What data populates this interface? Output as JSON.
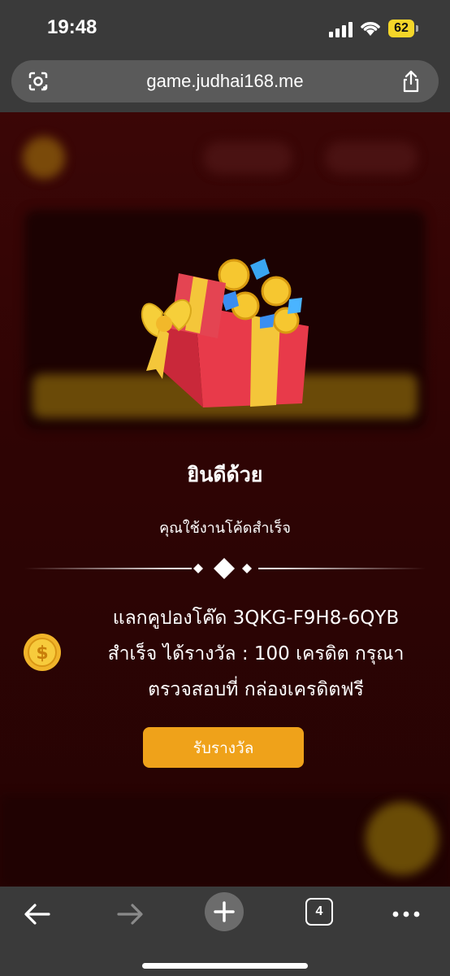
{
  "status_bar": {
    "time": "19:48",
    "battery": "62"
  },
  "browser": {
    "url": "game.judhai168.me",
    "open_tabs": "4"
  },
  "dialog": {
    "title": "ยินดีด้วย",
    "subtitle": "คุณใช้งานโค้ดสำเร็จ",
    "message_line1": "แลกคูปองโค๊ด 3QKG-F9H8-6QYB",
    "message_line2": "สำเร็จ ได้รางวัล : 100 เครดิต กรุณา",
    "message_line3": "ตรวจสอบที่ กล่องเครดิตฟรี",
    "button_label": "รับรางวัล"
  },
  "colors": {
    "accent": "#efa21a",
    "background": "#2a0404",
    "browser_chrome": "#3a3a3a"
  },
  "icons": [
    "signal-icon",
    "wifi-icon",
    "battery-icon",
    "lens-icon",
    "share-icon",
    "gift-box-icon",
    "coin-icon",
    "back-icon",
    "forward-icon",
    "plus-icon",
    "tabs-icon",
    "more-icon"
  ]
}
